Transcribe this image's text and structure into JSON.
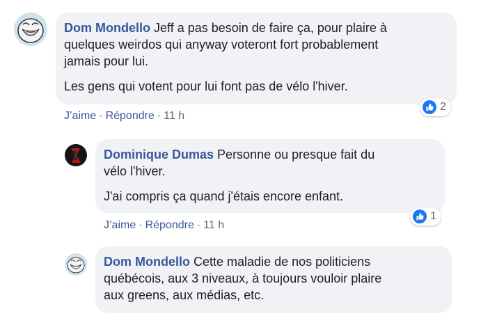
{
  "comments": [
    {
      "author": "Dom Mondello",
      "first_line": "Jeff a pas besoin de faire ça, pour plaire à",
      "lines": [
        "quelques weirdos qui anyway voteront fort probablement",
        "jamais pour lui."
      ],
      "paragraph2": "Les gens qui votent pour lui font pas de vélo l'hiver.",
      "reaction_count": "2",
      "actions": {
        "like": "J’aime",
        "reply": "Répondre",
        "time": "11 h"
      }
    },
    {
      "author": "Dominique Dumas",
      "first_line": "Personne ou presque fait du",
      "lines": [
        "vélo l'hiver."
      ],
      "paragraph2": "J'ai compris ça quand j'étais encore enfant.",
      "reaction_count": "1",
      "actions": {
        "like": "J’aime",
        "reply": "Répondre",
        "time": "11 h"
      }
    },
    {
      "author": "Dom Mondello",
      "first_line": "Cette maladie de nos politiciens",
      "lines": [
        "québécois, aux 3 niveaux, à toujours vouloir plaire",
        "aux greens, aux médias, etc."
      ]
    }
  ],
  "separator": "·",
  "colors": {
    "bubble": "#f0f2f5",
    "name": "#385898",
    "like_blue": "#1877f2",
    "meta": "#65676b"
  },
  "icons": {
    "reaction": "like-thumb-icon"
  }
}
